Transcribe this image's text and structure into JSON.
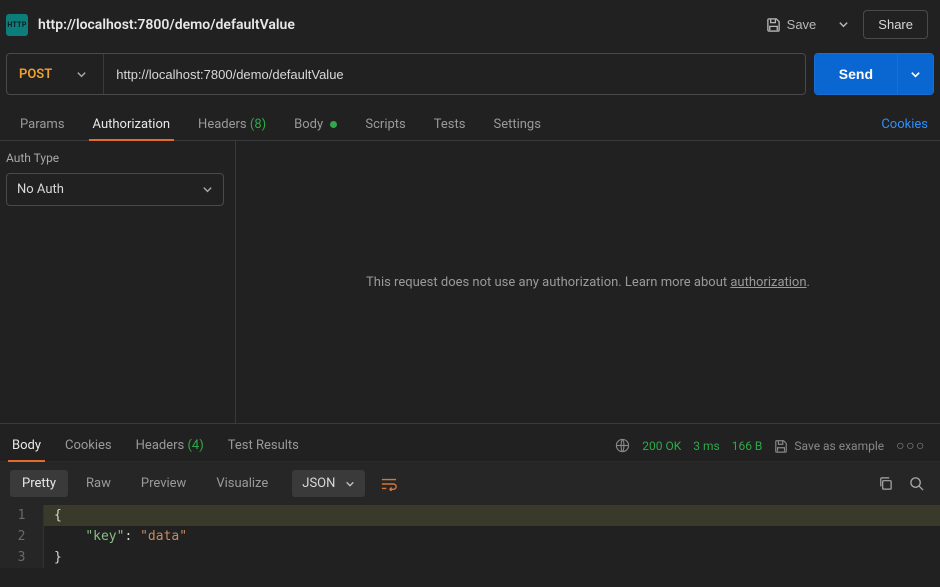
{
  "header": {
    "icon_text": "HTTP",
    "title": "http://localhost:7800/demo/defaultValue",
    "save_label": "Save",
    "share_label": "Share"
  },
  "request": {
    "method": "POST",
    "url": "http://localhost:7800/demo/defaultValue",
    "send_label": "Send"
  },
  "req_tabs": {
    "params": "Params",
    "authorization": "Authorization",
    "headers": "Headers",
    "headers_count": "(8)",
    "body": "Body",
    "scripts": "Scripts",
    "tests": "Tests",
    "settings": "Settings",
    "cookies_link": "Cookies"
  },
  "auth": {
    "type_label": "Auth Type",
    "selected": "No Auth",
    "message_prefix": "This request does not use any authorization. Learn more about ",
    "link_text": "authorization",
    "message_suffix": "."
  },
  "resp_tabs": {
    "body": "Body",
    "cookies": "Cookies",
    "headers": "Headers",
    "headers_count": "(4)",
    "test_results": "Test Results"
  },
  "status": {
    "code": "200 OK",
    "time": "3 ms",
    "size": "166 B",
    "save_example": "Save as example"
  },
  "format": {
    "pretty": "Pretty",
    "raw": "Raw",
    "preview": "Preview",
    "visualize": "Visualize",
    "lang": "JSON"
  },
  "response_body": {
    "lines": [
      {
        "n": "1",
        "raw": "{",
        "hl": true
      },
      {
        "n": "2",
        "raw": "    \"key\": \"data\""
      },
      {
        "n": "3",
        "raw": "}"
      }
    ],
    "json": {
      "key": "data"
    }
  }
}
